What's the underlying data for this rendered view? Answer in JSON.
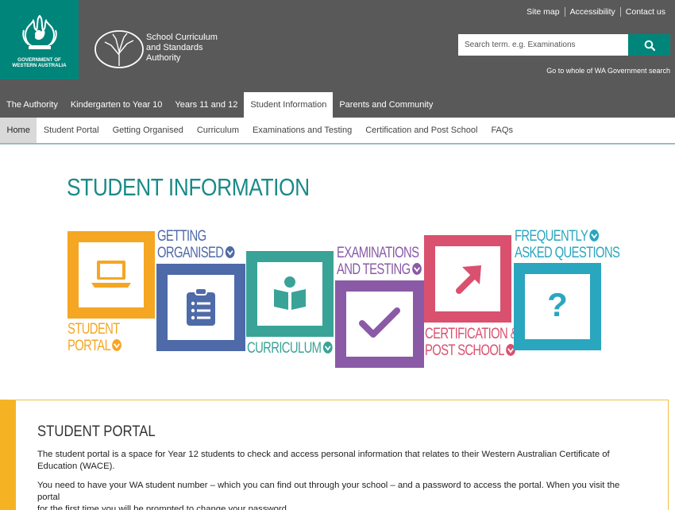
{
  "header": {
    "gov_logo_line1": "GOVERNMENT OF",
    "gov_logo_line2": "WESTERN AUSTRALIA",
    "org_name_line1": "School Curriculum",
    "org_name_line2": "and Standards",
    "org_name_line3": "Authority",
    "top_links": [
      "Site map",
      "Accessibility",
      "Contact us"
    ],
    "search_placeholder": "Search term. e.g. Examinations",
    "wa_gov_link": "Go to whole of WA Government search"
  },
  "primary_nav": [
    {
      "label": "The Authority",
      "active": false
    },
    {
      "label": "Kindergarten to Year 10",
      "active": false
    },
    {
      "label": "Years 11 and 12",
      "active": false
    },
    {
      "label": "Student Information",
      "active": true
    },
    {
      "label": "Parents and Community",
      "active": false
    }
  ],
  "secondary_nav": [
    {
      "label": "Home",
      "active": true
    },
    {
      "label": "Student Portal",
      "active": false
    },
    {
      "label": "Getting Organised",
      "active": false
    },
    {
      "label": "Curriculum",
      "active": false
    },
    {
      "label": "Examinations and Testing",
      "active": false
    },
    {
      "label": "Certification and Post School",
      "active": false
    },
    {
      "label": "FAQs",
      "active": false
    }
  ],
  "page_title": "STUDENT INFORMATION",
  "tiles": {
    "student_portal": {
      "line1": "STUDENT",
      "line2": "PORTAL",
      "color": "#f5a623",
      "icon": "laptop-icon"
    },
    "getting_organised": {
      "line1": "GETTING",
      "line2": "ORGANISED",
      "color": "#4e6aa8",
      "icon": "clipboard-icon"
    },
    "curriculum": {
      "line1": "CURRICULUM",
      "color": "#3aa397",
      "icon": "reader-icon"
    },
    "examinations": {
      "line1": "EXAMINATIONS",
      "line2": "AND TESTING",
      "color": "#8a5aa6",
      "icon": "checkmark-icon"
    },
    "certification": {
      "line1": "CERTIFICATION &",
      "line2": "POST SCHOOL",
      "color": "#d9516f",
      "icon": "arrow-up-right-icon"
    },
    "faqs": {
      "line1": "FREQUENTLY",
      "line2": "ASKED QUESTIONS",
      "color": "#2aa6bf",
      "icon": "question-mark-icon"
    }
  },
  "portal_section": {
    "heading": "STUDENT PORTAL",
    "para1_line1": "The student portal is a space for Year 12 students to check and access personal information that relates to their Western Australian Certificate of",
    "para1_line2": "Education (WACE).",
    "para2_line1": "You need to have your WA student number – which you can find out through your school – and a password to access the portal. When you visit the portal",
    "para2_line2": "for the first time you will be prompted to change your password."
  }
}
